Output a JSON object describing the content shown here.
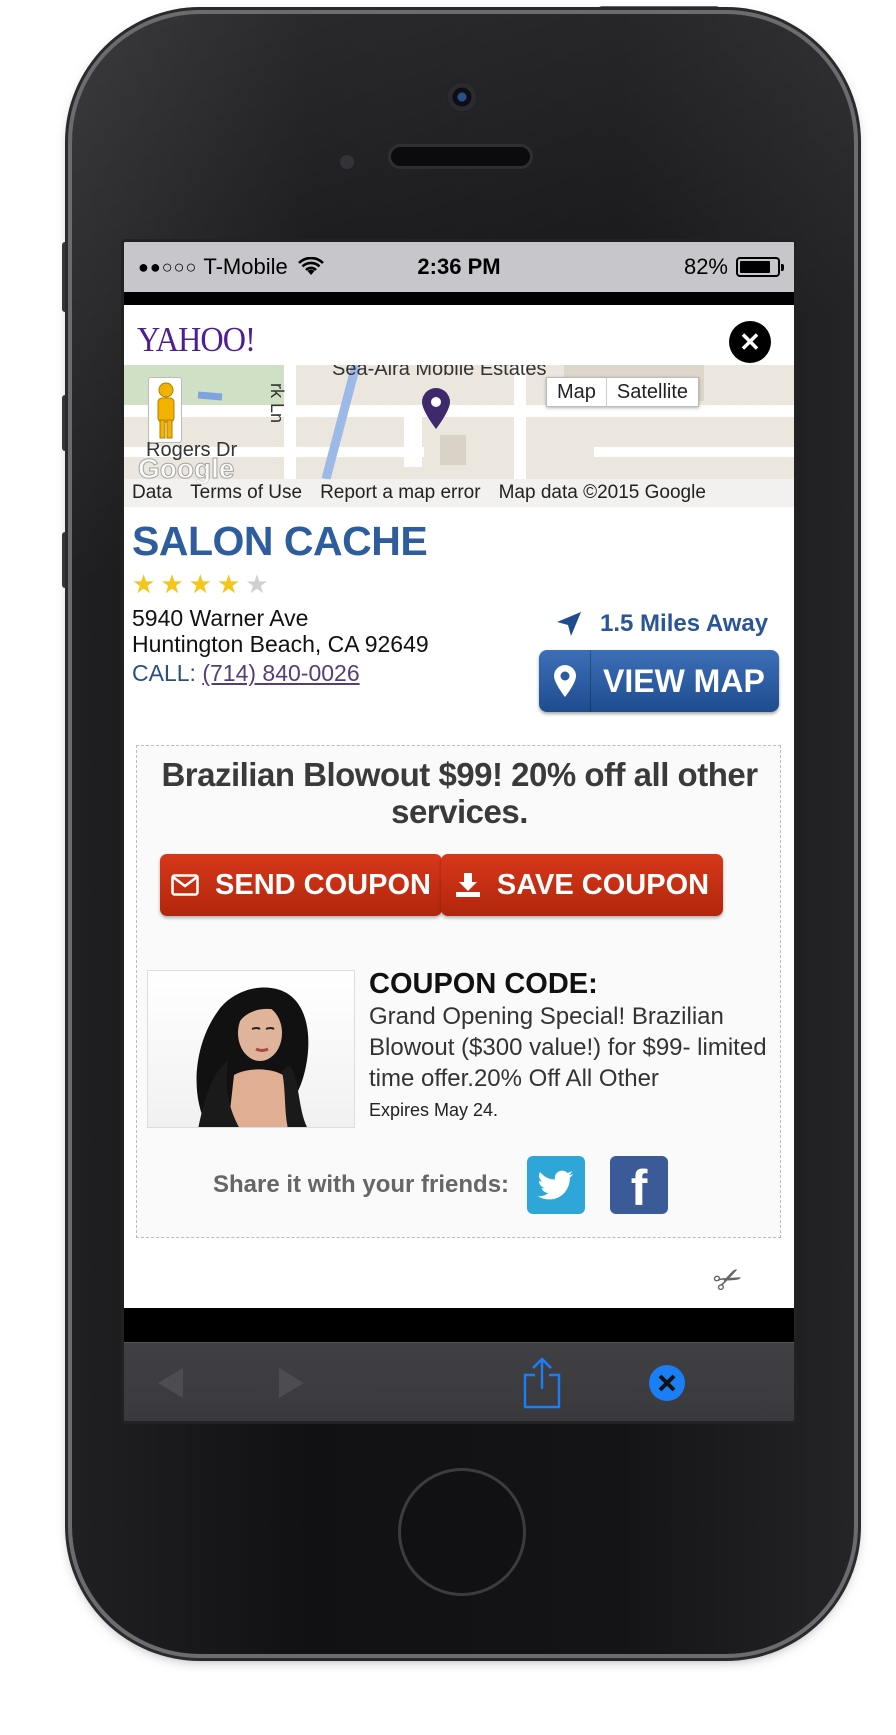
{
  "status_bar": {
    "signal": "●●○○○",
    "carrier": "T-Mobile",
    "time": "2:36 PM",
    "battery_percent": "82%",
    "battery_level": 0.82
  },
  "header": {
    "logo": "YAHOO!"
  },
  "map": {
    "place_label": "Sea-Aira Mobile Estates",
    "street_label": "Rogers Dr",
    "street_label_2": "rk Ln",
    "watermark": "Google",
    "toggle": [
      "Map",
      "Satellite"
    ],
    "footer": [
      "Data",
      "Terms of Use",
      "Report a map error",
      "Map data ©2015 Google"
    ]
  },
  "business": {
    "name": "SALON CACHE",
    "rating": 4,
    "rating_max": 5,
    "address_line1": "5940 Warner Ave",
    "address_line2": "Huntington Beach, CA 92649",
    "call_label": "CALL:",
    "phone": "(714) 840-0026",
    "distance": "1.5 Miles Away",
    "view_map_label": "VIEW MAP"
  },
  "coupon": {
    "headline": "Brazilian Blowout $99! 20% off all other services.",
    "send_label": "SEND COUPON",
    "save_label": "SAVE COUPON",
    "code_title": "COUPON CODE:",
    "description": "Grand Opening Special! Brazilian Blowout ($300 value!) for $99- limited time offer.20% Off All Other",
    "expires": "Expires May 24.",
    "share_label": "Share it with your friends:"
  },
  "colors": {
    "brand_blue": "#2e5d9e",
    "coupon_red": "#c22e12",
    "star_yellow": "#f5c518",
    "star_gray": "#d0d0d0",
    "yahoo_purple": "#4e1e95",
    "ios_blue": "#1a7ef5"
  },
  "icons": {
    "close": "close-x-icon",
    "pin": "map-pin-icon",
    "navigation": "navigation-arrow-icon",
    "send": "envelope-icon",
    "save": "download-icon",
    "twitter": "twitter-bird-icon",
    "facebook": "facebook-f-icon",
    "scissors": "scissors-icon",
    "back": "back-arrow-icon",
    "forward": "forward-arrow-icon",
    "share": "share-icon",
    "close_browser": "close-circle-icon"
  }
}
